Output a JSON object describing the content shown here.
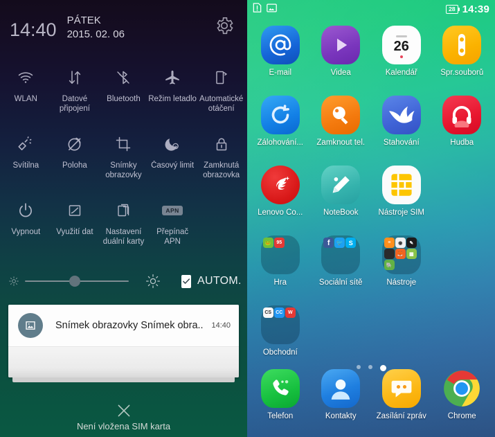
{
  "shade": {
    "clock": "14:40",
    "day": "PÁTEK",
    "date": "2015. 02. 06",
    "settings_icon": "gear-icon",
    "toggles": [
      [
        {
          "id": "wlan",
          "label": "WLAN",
          "icon": "wifi-icon"
        },
        {
          "id": "data",
          "label": "Datové\npřipojení",
          "icon": "data-transfer-icon"
        },
        {
          "id": "bluetooth",
          "label": "Bluetooth",
          "icon": "bluetooth-off-icon"
        },
        {
          "id": "airplane",
          "label": "Režim letadlo",
          "icon": "airplane-icon"
        },
        {
          "id": "rotate",
          "label": "Automatické\notáčení",
          "icon": "auto-rotate-icon"
        }
      ],
      [
        {
          "id": "flashlight",
          "label": "Svítilna",
          "icon": "flashlight-icon"
        },
        {
          "id": "location",
          "label": "Poloha",
          "icon": "location-off-icon"
        },
        {
          "id": "screenshot",
          "label": "Snímky\nobrazovky",
          "icon": "crop-icon"
        },
        {
          "id": "timeout",
          "label": "Časový limit",
          "icon": "moon-sleep-icon"
        },
        {
          "id": "lockscreen",
          "label": "Zamknutá\nobrazovka",
          "icon": "lock-icon"
        }
      ],
      [
        {
          "id": "poweroff",
          "label": "Vypnout",
          "icon": "power-icon"
        },
        {
          "id": "datausage",
          "label": "Využití dat",
          "icon": "chart-icon"
        },
        {
          "id": "dualsim",
          "label": "Nastavení\nduální karty",
          "icon": "cards-icon"
        },
        {
          "id": "apn",
          "label": "Přepínač\nAPN",
          "icon": "apn-chip-icon",
          "chip": "APN"
        }
      ]
    ],
    "brightness": {
      "low_icon": "brightness-low-icon",
      "high_icon": "brightness-high-icon",
      "value_percent": 48,
      "auto_label": "AUTOM.",
      "auto_checked": true
    },
    "notification": {
      "icon": "image-icon",
      "title": "Snímek obrazovky Snímek obra..",
      "time": "14:40"
    },
    "footer": {
      "clear_icon": "close-x-icon",
      "sim_text": "Není vložena SIM karta"
    }
  },
  "home": {
    "statusbar": {
      "sim_alert_icon": "sim-alert-icon",
      "screenshot_icon": "image-icon",
      "battery": "28",
      "time": "14:39"
    },
    "rows": [
      [
        {
          "id": "email",
          "label": "E-mail",
          "icon": "at-sign-icon",
          "kind": "app"
        },
        {
          "id": "videa",
          "label": "Videa",
          "icon": "play-icon",
          "kind": "app"
        },
        {
          "id": "kalendar",
          "label": "Kalendář",
          "icon": "calendar-icon",
          "kind": "app",
          "day": "26"
        },
        {
          "id": "spr-souboru",
          "label": "Spr.souborů",
          "icon": "file-manager-icon",
          "kind": "app"
        }
      ],
      [
        {
          "id": "zalohovani",
          "label": "Zálohování...",
          "icon": "backup-restore-icon",
          "kind": "app"
        },
        {
          "id": "zamknout-tel",
          "label": "Zamknout tel.",
          "icon": "lock-phone-icon",
          "kind": "app"
        },
        {
          "id": "stahovani",
          "label": "Stahování",
          "icon": "download-bird-icon",
          "kind": "app"
        },
        {
          "id": "hudba",
          "label": "Hudba",
          "icon": "headphones-icon",
          "kind": "app"
        }
      ],
      [
        {
          "id": "lenovo-co",
          "label": "Lenovo Co...",
          "icon": "lenovo-companion-icon",
          "kind": "app"
        },
        {
          "id": "notebook",
          "label": "NoteBook",
          "icon": "pencil-icon",
          "kind": "app"
        },
        {
          "id": "nastroje-sim",
          "label": "Nástroje SIM",
          "icon": "sim-chip-icon",
          "kind": "app"
        }
      ],
      [
        {
          "id": "hra",
          "label": "Hra",
          "kind": "folder",
          "minis": [
            "#6fbf3a",
            "#e53935"
          ]
        },
        {
          "id": "socialni-site",
          "label": "Sociální sítě",
          "kind": "folder",
          "minis": [
            "#3b5998",
            "#1da1f2",
            "#00aff0"
          ]
        },
        {
          "id": "nastroje",
          "label": "Nástroje",
          "kind": "folder",
          "minis": [
            "#ff8f1c",
            "#f5f5f5",
            "#1c1c1c",
            "#2b2b2b",
            "#f26322",
            "#8bc34a",
            "#62b245"
          ]
        }
      ],
      [
        {
          "id": "obchodni",
          "label": "Obchodní",
          "kind": "folder",
          "minis": [
            "#f7f7f7",
            "#2196f3",
            "#e53935"
          ]
        }
      ]
    ],
    "page_dots": {
      "count": 3,
      "active": 2
    },
    "dock": [
      {
        "id": "telefon",
        "label": "Telefon",
        "icon": "phone-icon"
      },
      {
        "id": "kontakty",
        "label": "Kontakty",
        "icon": "contacts-icon"
      },
      {
        "id": "zasilani-zprav",
        "label": "Zasílání zpráv",
        "icon": "message-icon"
      },
      {
        "id": "chrome",
        "label": "Chrome",
        "icon": "chrome-icon"
      }
    ]
  }
}
